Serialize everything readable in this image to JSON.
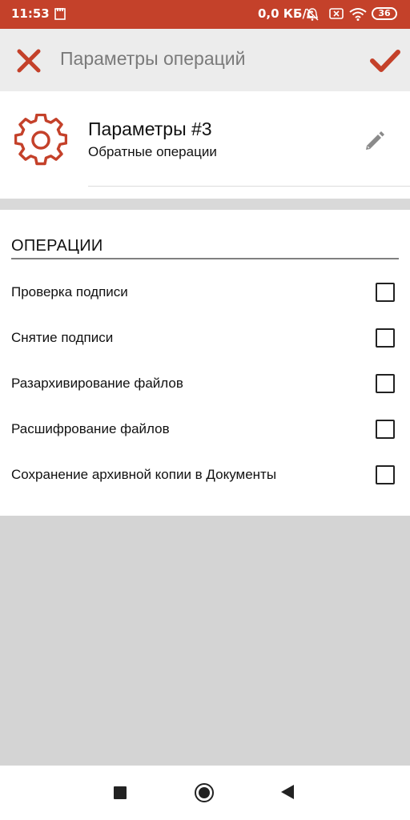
{
  "status_bar": {
    "time": "11:53",
    "network_speed": "0,0 КБ/с",
    "battery": "36",
    "icons": [
      "sim-icon",
      "alarm-off-icon",
      "card-icon",
      "wifi-icon",
      "battery-icon"
    ]
  },
  "toolbar": {
    "title": "Параметры операций",
    "close_icon": "close-icon",
    "confirm_icon": "check-icon"
  },
  "profile": {
    "name": "Параметры #3",
    "description": "Обратные операции",
    "icon": "gear-icon",
    "edit_icon": "pencil-icon"
  },
  "operations": {
    "section_title": "ОПЕРАЦИИ",
    "items": [
      {
        "label": "Проверка подписи",
        "checked": false
      },
      {
        "label": "Снятие подписи",
        "checked": false
      },
      {
        "label": "Разархивирование файлов",
        "checked": false
      },
      {
        "label": "Расшифрование файлов",
        "checked": false
      },
      {
        "label": "Сохранение архивной копии в Документы",
        "checked": false
      }
    ]
  },
  "navigation": {
    "icons": [
      "recent-apps-icon",
      "home-icon",
      "back-icon"
    ]
  },
  "colors": {
    "accent": "#c4412a",
    "status_bar": "#c4412a",
    "toolbar": "#ececec",
    "background": "#d4d4d4"
  }
}
